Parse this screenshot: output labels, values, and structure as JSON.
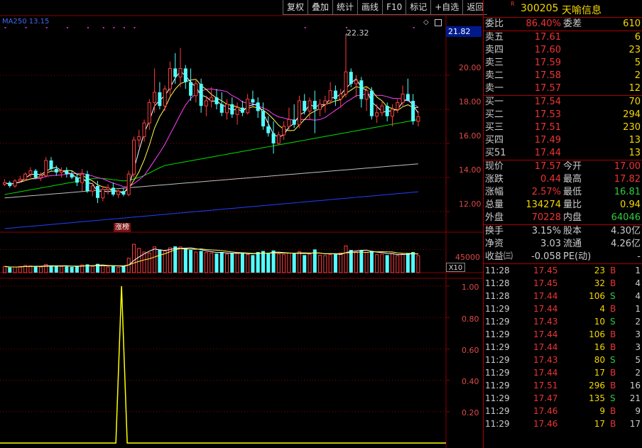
{
  "toolbar": {
    "buttons": [
      "复权",
      "叠加",
      "统计",
      "画线",
      "F10",
      "标记",
      "+自选",
      "返回"
    ]
  },
  "chart": {
    "ma_label": "MA250  13.15",
    "price_axis": [
      "20.00",
      "18.00",
      "16.00",
      "14.00",
      "12.00"
    ],
    "current_price_tag": "21.82",
    "high_label": "22.32",
    "limit_up_tag": "涨榜",
    "vol_axis": "45000",
    "vol_unit": "X10",
    "ind_axis": [
      "1.00",
      "0.80",
      "0.60",
      "0.40",
      "0.20"
    ],
    "colors": {
      "up": "#ff3c3c",
      "down": "#54ffff",
      "ma5": "#ffffff",
      "ma10": "#ffff55",
      "ma20": "#ff40ff",
      "ma60": "#00e000",
      "ma120": "#c0c0c0",
      "ma250": "#2040ff",
      "indicator": "#ffff00",
      "grid": "#8a0000"
    }
  },
  "chart_data": {
    "type": "candlestick",
    "price_range": [
      11.0,
      23.5
    ],
    "volume_max": 62000,
    "indicator_range": [
      0,
      1.05
    ],
    "candles": [
      [
        13.6,
        13.9,
        13.5,
        13.7
      ],
      [
        13.7,
        13.8,
        13.4,
        13.5
      ],
      [
        13.5,
        13.9,
        13.4,
        13.8
      ],
      [
        13.8,
        14.1,
        13.7,
        13.9
      ],
      [
        13.9,
        14.3,
        13.8,
        14.2
      ],
      [
        14.2,
        14.6,
        14.0,
        14.4
      ],
      [
        14.4,
        14.5,
        13.9,
        14.0
      ],
      [
        14.0,
        14.3,
        13.8,
        14.1
      ],
      [
        14.1,
        15.2,
        14.0,
        15.0
      ],
      [
        15.0,
        15.2,
        14.4,
        14.5
      ],
      [
        14.5,
        14.7,
        14.1,
        14.3
      ],
      [
        14.3,
        14.6,
        14.0,
        14.4
      ],
      [
        14.4,
        14.6,
        14.0,
        14.2
      ],
      [
        14.2,
        14.4,
        13.9,
        14.0
      ],
      [
        14.0,
        14.2,
        13.5,
        13.7
      ],
      [
        13.7,
        14.5,
        13.2,
        14.2
      ],
      [
        14.2,
        14.4,
        13.1,
        13.2
      ],
      [
        13.2,
        13.7,
        12.9,
        13.5
      ],
      [
        13.5,
        13.8,
        12.5,
        12.8
      ],
      [
        12.8,
        13.5,
        12.6,
        13.3
      ],
      [
        13.3,
        13.6,
        13.0,
        13.4
      ],
      [
        13.4,
        13.7,
        12.9,
        13.0
      ],
      [
        13.0,
        13.3,
        12.8,
        13.2
      ],
      [
        13.2,
        13.4,
        12.9,
        13.0
      ],
      [
        13.0,
        14.4,
        12.9,
        14.2
      ],
      [
        14.2,
        16.4,
        14.0,
        16.2
      ],
      [
        16.2,
        16.8,
        15.8,
        16.4
      ],
      [
        16.4,
        17.4,
        16.1,
        17.2
      ],
      [
        17.2,
        18.6,
        16.8,
        18.4
      ],
      [
        18.4,
        20.4,
        17.8,
        19.0
      ],
      [
        19.0,
        19.6,
        18.0,
        18.2
      ],
      [
        18.2,
        19.4,
        17.9,
        19.2
      ],
      [
        19.2,
        20.8,
        18.8,
        20.4
      ],
      [
        20.4,
        21.3,
        19.5,
        19.9
      ],
      [
        19.9,
        21.6,
        19.3,
        20.4
      ],
      [
        20.4,
        20.6,
        19.2,
        19.6
      ],
      [
        19.6,
        20.4,
        18.5,
        18.8
      ],
      [
        18.8,
        19.8,
        18.4,
        19.5
      ],
      [
        19.5,
        19.8,
        17.8,
        18.2
      ],
      [
        18.2,
        18.8,
        17.6,
        18.5
      ],
      [
        18.5,
        19.3,
        18.1,
        18.7
      ],
      [
        18.7,
        19.2,
        18.0,
        18.3
      ],
      [
        18.3,
        19.0,
        17.6,
        17.8
      ],
      [
        17.8,
        18.6,
        17.4,
        18.3
      ],
      [
        18.3,
        18.7,
        17.5,
        17.7
      ],
      [
        17.7,
        18.4,
        17.1,
        18.1
      ],
      [
        18.1,
        18.5,
        17.6,
        17.8
      ],
      [
        17.8,
        18.9,
        17.7,
        18.6
      ],
      [
        18.6,
        19.1,
        18.2,
        18.4
      ],
      [
        18.4,
        18.7,
        17.5,
        17.9
      ],
      [
        17.9,
        18.4,
        16.8,
        17.0
      ],
      [
        17.0,
        17.6,
        16.4,
        16.6
      ],
      [
        16.6,
        17.3,
        15.4,
        16.0
      ],
      [
        16.0,
        16.7,
        15.9,
        16.5
      ],
      [
        16.5,
        17.3,
        16.2,
        17.0
      ],
      [
        17.0,
        18.1,
        16.8,
        17.4
      ],
      [
        17.4,
        18.3,
        16.9,
        17.1
      ],
      [
        17.1,
        18.8,
        16.9,
        18.5
      ],
      [
        18.5,
        18.9,
        17.7,
        17.9
      ],
      [
        17.9,
        18.7,
        17.4,
        18.5
      ],
      [
        18.5,
        19.1,
        16.6,
        18.0
      ],
      [
        18.0,
        18.6,
        17.6,
        18.3
      ],
      [
        18.3,
        18.8,
        17.8,
        18.5
      ],
      [
        18.5,
        19.6,
        18.3,
        19.1
      ],
      [
        19.1,
        19.4,
        18.2,
        18.6
      ],
      [
        18.6,
        19.2,
        18.1,
        18.9
      ],
      [
        18.9,
        22.32,
        18.7,
        20.2
      ],
      [
        20.2,
        20.4,
        19.3,
        19.5
      ],
      [
        19.5,
        20.0,
        18.7,
        19.7
      ],
      [
        19.7,
        19.9,
        18.1,
        18.6
      ],
      [
        18.6,
        19.3,
        17.9,
        19.1
      ],
      [
        19.1,
        19.3,
        17.4,
        17.6
      ],
      [
        17.6,
        18.3,
        17.2,
        17.8
      ],
      [
        17.8,
        18.5,
        17.6,
        18.2
      ],
      [
        18.2,
        18.4,
        17.3,
        17.6
      ],
      [
        17.6,
        18.3,
        17.0,
        18.0
      ],
      [
        18.0,
        18.6,
        17.8,
        18.4
      ],
      [
        18.4,
        19.4,
        18.2,
        18.9
      ],
      [
        18.9,
        19.8,
        18.5,
        18.5
      ],
      [
        18.5,
        18.9,
        17.1,
        17.3
      ],
      [
        17.3,
        17.9,
        17.0,
        17.57
      ]
    ],
    "volumes": [
      12000,
      10000,
      11000,
      12000,
      14000,
      13000,
      12000,
      11000,
      16000,
      14000,
      13000,
      12000,
      12000,
      11000,
      13000,
      15000,
      16000,
      12000,
      17000,
      14000,
      11000,
      13000,
      10000,
      12000,
      28000,
      55000,
      47000,
      40000,
      38000,
      50000,
      45000,
      42000,
      48000,
      51000,
      50000,
      47000,
      44000,
      40000,
      42000,
      39000,
      38000,
      37000,
      40000,
      36000,
      38000,
      37000,
      39000,
      35000,
      34000,
      40000,
      42000,
      38000,
      43000,
      36000,
      35000,
      38000,
      37000,
      41000,
      34000,
      36000,
      45000,
      34000,
      33000,
      35000,
      36000,
      38000,
      52000,
      44000,
      40000,
      43000,
      39000,
      42000,
      35000,
      36000,
      34000,
      37000,
      33000,
      36000,
      38000,
      40000,
      33000
    ],
    "indicator_spike_index": 35
  },
  "quote": {
    "r_mark": "R",
    "code": "300205",
    "name": "天喻信息",
    "weibi": {
      "label": "委比",
      "value": "86.40%",
      "label2": "委差",
      "value2": "610"
    },
    "asks": [
      {
        "label": "卖五",
        "price": "17.61",
        "vol": "6"
      },
      {
        "label": "卖四",
        "price": "17.60",
        "vol": "23"
      },
      {
        "label": "卖三",
        "price": "17.59",
        "vol": "5"
      },
      {
        "label": "卖二",
        "price": "17.58",
        "vol": "2"
      },
      {
        "label": "卖一",
        "price": "17.57",
        "vol": "12"
      }
    ],
    "bids": [
      {
        "label": "买一",
        "price": "17.54",
        "vol": "70"
      },
      {
        "label": "买二",
        "price": "17.53",
        "vol": "294"
      },
      {
        "label": "买三",
        "price": "17.51",
        "vol": "230"
      },
      {
        "label": "买四",
        "price": "17.49",
        "vol": "13"
      },
      {
        "label": "买51",
        "price": "17.44",
        "vol": "13"
      }
    ],
    "stats1": [
      {
        "l": "现价",
        "v": "17.57",
        "l2": "今开",
        "v2": "17.00",
        "c": "red",
        "c2": "red"
      },
      {
        "l": "涨跌",
        "v": "0.44",
        "l2": "最高",
        "v2": "17.82",
        "c": "red",
        "c2": "red"
      },
      {
        "l": "涨幅",
        "v": "2.57%",
        "l2": "最低",
        "v2": "16.81",
        "c": "red",
        "c2": "green"
      },
      {
        "l": "总量",
        "v": "134274",
        "l2": "量比",
        "v2": "0.94",
        "c": "yellow",
        "c2": "yellow"
      },
      {
        "l": "外盘",
        "v": "70228",
        "l2": "内盘",
        "v2": "64046",
        "c": "red",
        "c2": "green"
      }
    ],
    "stats2": [
      {
        "l": "换手",
        "v": "3.15%",
        "l2": "股本",
        "v2": "4.30亿"
      },
      {
        "l": "净资",
        "v": "3.03",
        "l2": "流通",
        "v2": "4.26亿"
      },
      {
        "l": "收益㈢",
        "v": "-0.058",
        "l2": "PE(动)",
        "v2": "-"
      }
    ],
    "ticks": [
      {
        "t": "11:28",
        "p": "17.45",
        "v": "23",
        "s": "B",
        "n": "1"
      },
      {
        "t": "11:28",
        "p": "17.45",
        "v": "32",
        "s": "B",
        "n": "4"
      },
      {
        "t": "11:28",
        "p": "17.44",
        "v": "106",
        "s": "S",
        "n": "4"
      },
      {
        "t": "11:29",
        "p": "17.44",
        "v": "4",
        "s": "B",
        "n": "1"
      },
      {
        "t": "11:29",
        "p": "17.43",
        "v": "10",
        "s": "S",
        "n": "2"
      },
      {
        "t": "11:29",
        "p": "17.44",
        "v": "106",
        "s": "B",
        "n": "3"
      },
      {
        "t": "11:29",
        "p": "17.44",
        "v": "16",
        "s": "B",
        "n": "3"
      },
      {
        "t": "11:29",
        "p": "17.43",
        "v": "80",
        "s": "S",
        "n": "5"
      },
      {
        "t": "11:29",
        "p": "17.44",
        "v": "17",
        "s": "B",
        "n": "2"
      },
      {
        "t": "11:29",
        "p": "17.51",
        "v": "296",
        "s": "B",
        "n": "16"
      },
      {
        "t": "11:29",
        "p": "17.47",
        "v": "135",
        "s": "S",
        "n": "21"
      },
      {
        "t": "11:29",
        "p": "17.46",
        "v": "9",
        "s": "B",
        "n": "9"
      },
      {
        "t": "11:29",
        "p": "17.46",
        "v": "17",
        "s": "B",
        "n": "17"
      }
    ]
  }
}
